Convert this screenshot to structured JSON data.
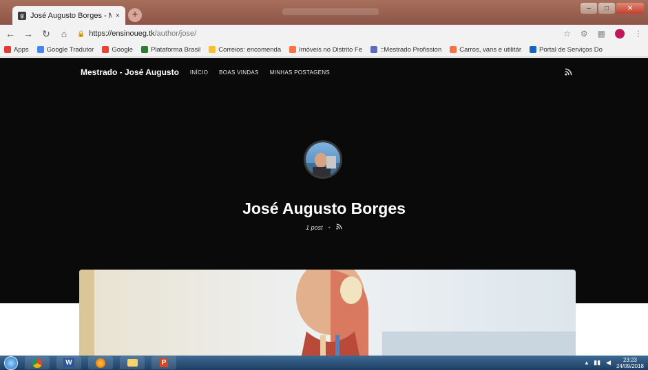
{
  "browser": {
    "tab_title": "José Augusto Borges - Mestrado",
    "tab_close": "×",
    "new_tab": "+",
    "url_host": "https://ensinoueg.tk",
    "url_path": "/author/jose/"
  },
  "bookmarks": [
    {
      "label": "Apps",
      "color": "#e53935"
    },
    {
      "label": "Google Tradutor",
      "color": "#4285f4"
    },
    {
      "label": "Google",
      "color": "#ea4335"
    },
    {
      "label": "Plataforma Brasil",
      "color": "#2e7d32"
    },
    {
      "label": "Correios: encomenda",
      "color": "#fbc02d"
    },
    {
      "label": "Imóveis no Distrito Fe",
      "color": "#ff7043"
    },
    {
      "label": "::Mestrado Profission",
      "color": "#5c6bc0"
    },
    {
      "label": "Carros, vans e utilitár",
      "color": "#ff7043"
    },
    {
      "label": "Portal de Serviços Do",
      "color": "#1565c0"
    }
  ],
  "site": {
    "title": "Mestrado - José Augusto",
    "nav": [
      "INÍCIO",
      "BOAS VINDAS",
      "MINHAS POSTAGENS"
    ]
  },
  "author": {
    "name": "José Augusto Borges",
    "post_count": "1 post",
    "separator": "•"
  },
  "taskbar": {
    "apps": [
      "",
      "W",
      "",
      "",
      "P"
    ],
    "time": "23:23",
    "date": "24/09/2018"
  }
}
